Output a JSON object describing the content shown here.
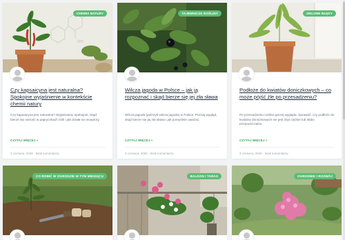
{
  "posts": [
    {
      "badge": "Chemia natury",
      "title": "Czy kapsaicyna jest naturalna? Spokojne wyjaśnienie w kontekście chemii natury",
      "excerpt": "Czy kapsaicyna jest naturalna? Wyjaśniamy spokojnie, skąd bierze się ostrość w papryczkach chili i jak działa na receptory.",
      "read_more": "Czytaj więcej »",
      "date": "3 czerwca, 2026",
      "comments": "Brak komentarzy"
    },
    {
      "badge": "Tajemnicze rośliny",
      "title": "Wilcza jagoda w Polsce – jak ją rozpoznać i skąd bierze się jej zła sława",
      "excerpt": "Wilcza jagoda (pokrzyk wilcza jagoda) w Polsce. Poznaj wygląd, skąd bierze się jej zła sława i jak pomyślnie uważać.",
      "read_more": "Czytaj więcej »",
      "date": "3 czerwca, 2026",
      "comments": "Brak komentarzy"
    },
    {
      "badge": "Zielone błędy",
      "title": "Podłoże do kwiatów doniczkowych – co może pójść źle po przesadzeniu?",
      "excerpt": "Po przesadzeniu roślina gorzej wygląda. Sprawdź, czy podłoże do kwiatów doniczkowych nie jest zbyt ciężkie lub słabo przepuszczalne.",
      "read_more": "Czytaj więcej »",
      "date": "3 czerwca, 2026",
      "comments": "Brak komentarzy"
    },
    {
      "badge": "Co robić w ogrodzie w tym miesiącu"
    },
    {
      "badge": "Balkon i taras"
    },
    {
      "badge": "Ogrodnik i rozwój"
    }
  ]
}
